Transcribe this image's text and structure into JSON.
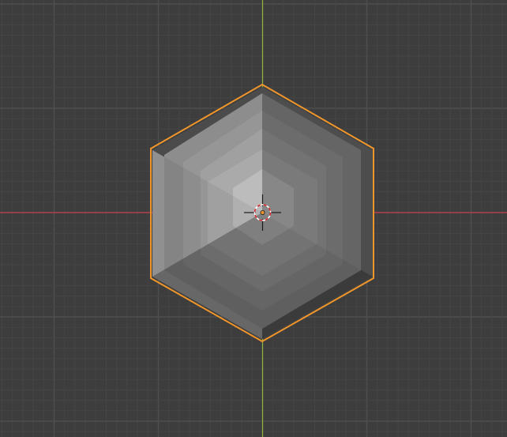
{
  "viewport": {
    "view": "top-orthographic",
    "background_color": "#3d3d3d",
    "grid_minor_color": "#454545",
    "grid_major_color": "#4f4f4f",
    "x_axis_color": "#c43f4f",
    "y_axis_color": "#8cb63d",
    "object": {
      "name": "",
      "shape": "hexagonal-pyramid",
      "selected": true,
      "outline_color": "#f0962b",
      "face_colors": {
        "top_light": "#bcbcbc",
        "top_mid": "#a6a6a6",
        "left": "#999999",
        "right": "#6b6b6b",
        "bottom_right": "#585858",
        "bottom": "#4b4b4b"
      }
    },
    "cursor_3d": {
      "ring_color_a": "#ffffff",
      "ring_color_b": "#d6262a"
    },
    "origin_point_color": "#f0962b"
  }
}
